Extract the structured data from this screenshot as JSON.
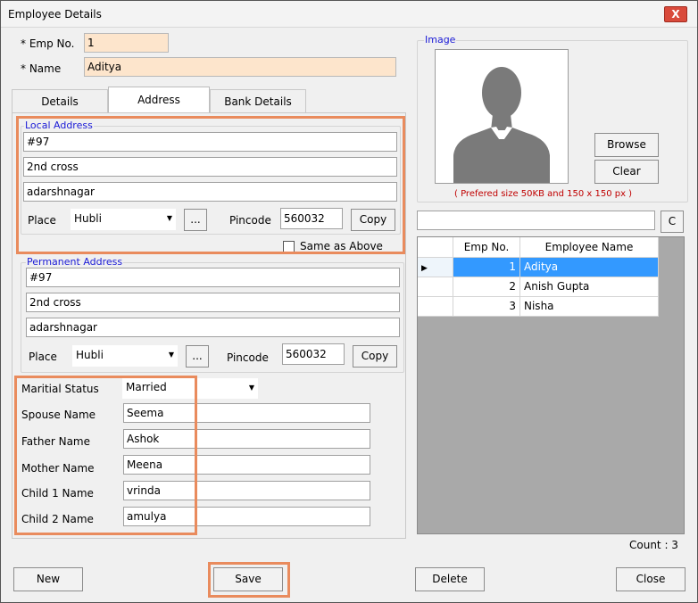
{
  "window": {
    "title": "Employee Details",
    "close_glyph": "X"
  },
  "header": {
    "emp_no_label": "* Emp No.",
    "emp_no_value": "1",
    "name_label": "* Name",
    "name_value": "Aditya"
  },
  "tabs": [
    {
      "label": "Details",
      "active": false
    },
    {
      "label": "Address",
      "active": true
    },
    {
      "label": "Bank Details",
      "active": false
    }
  ],
  "local_address": {
    "legend": "Local Address",
    "line1": "#97",
    "line2": "2nd cross",
    "line3": "adarshnagar",
    "place_label": "Place",
    "place_value": "Hubli",
    "ellipsis_label": "...",
    "pincode_label": "Pincode",
    "pincode_value": "560032",
    "copy_label": "Copy",
    "same_as_above_label": "Same as Above",
    "same_as_above_checked": false
  },
  "permanent_address": {
    "legend": "Permanent Address",
    "line1": "#97",
    "line2": "2nd cross",
    "line3": "adarshnagar",
    "place_label": "Place",
    "place_value": "Hubli",
    "ellipsis_label": "...",
    "pincode_label": "Pincode",
    "pincode_value": "560032",
    "copy_label": "Copy"
  },
  "family": {
    "marital_status_label": "Maritial Status",
    "marital_status_value": "Married",
    "spouse_label": "Spouse Name",
    "spouse_value": "Seema",
    "father_label": "Father Name",
    "father_value": "Ashok",
    "mother_label": "Mother Name",
    "mother_value": "Meena",
    "child1_label": "Child 1 Name",
    "child1_value": "vrinda",
    "child2_label": "Child 2 Name",
    "child2_value": "amulya"
  },
  "image_panel": {
    "legend": "Image",
    "browse_label": "Browse",
    "clear_label": "Clear",
    "size_note": "( Prefered size 50KB and 150 x 150 px )"
  },
  "search": {
    "value": "",
    "clear_label": "C"
  },
  "grid": {
    "columns": [
      "Emp No.",
      "Employee Name"
    ],
    "rows": [
      {
        "emp_no": "1",
        "name": "Aditya",
        "selected": true
      },
      {
        "emp_no": "2",
        "name": "Anish Gupta",
        "selected": false
      },
      {
        "emp_no": "3",
        "name": "Nisha",
        "selected": false
      }
    ],
    "row_indicator": "▶",
    "count_label": "Count : 3"
  },
  "footer": {
    "new_label": "New",
    "save_label": "Save",
    "delete_label": "Delete",
    "close_label": "Close"
  },
  "colors": {
    "required_field_bg": "#fde5cc",
    "highlight_border": "#e98b5d",
    "group_legend": "#1a1ad6",
    "grid_selection": "#3399ff",
    "note_text": "#c00000"
  }
}
